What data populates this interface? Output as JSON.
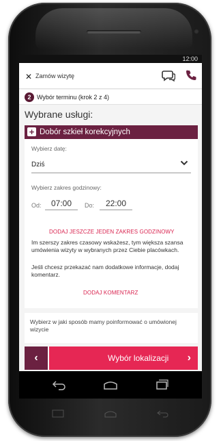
{
  "status_bar": {
    "time": "12:00"
  },
  "header": {
    "title": "Zamów wizytę"
  },
  "step": {
    "number": "2",
    "label": "Wybór terminu (krok 2 z 4)"
  },
  "section_title": "Wybrane usługi:",
  "service": {
    "name": "Dobór szkieł korekcyjnych"
  },
  "date": {
    "label": "Wybierz datę:",
    "value": "Dziś"
  },
  "time_range": {
    "label": "Wybierz zakres godzinowy:",
    "from_label": "Od:",
    "from_value": "07:00",
    "to_label": "Do:",
    "to_value": "22:00"
  },
  "add_range_link": "DODAJ JESZCZE JEDEN ZAKRES GODZINOWY",
  "info_text": "Im szerszy zakres czasowy wskażesz, tym większa szansa umówienia wizyty w wybranych przez Ciebie placówkach.",
  "comment_hint": "Jeśli chcesz przekazać nam dodatkowe informacje, dodaj komentarz.",
  "add_comment_link": "DODAJ KOMENTARZ",
  "notify_text": "Wybierz w jaki sposób mamy poinformować o umówionej wizycie",
  "footer": {
    "back_label": "‹",
    "next_label": "Wybór lokalizacji",
    "next_arrow": "›"
  },
  "colors": {
    "accent_dark": "#6b2141",
    "accent_red": "#e62754",
    "link_red": "#d9234f"
  },
  "icons": [
    "close-icon",
    "chat-icon",
    "phone-icon",
    "plus-icon",
    "chevron-down-icon",
    "nav-back-icon",
    "nav-home-icon",
    "nav-recents-icon"
  ]
}
